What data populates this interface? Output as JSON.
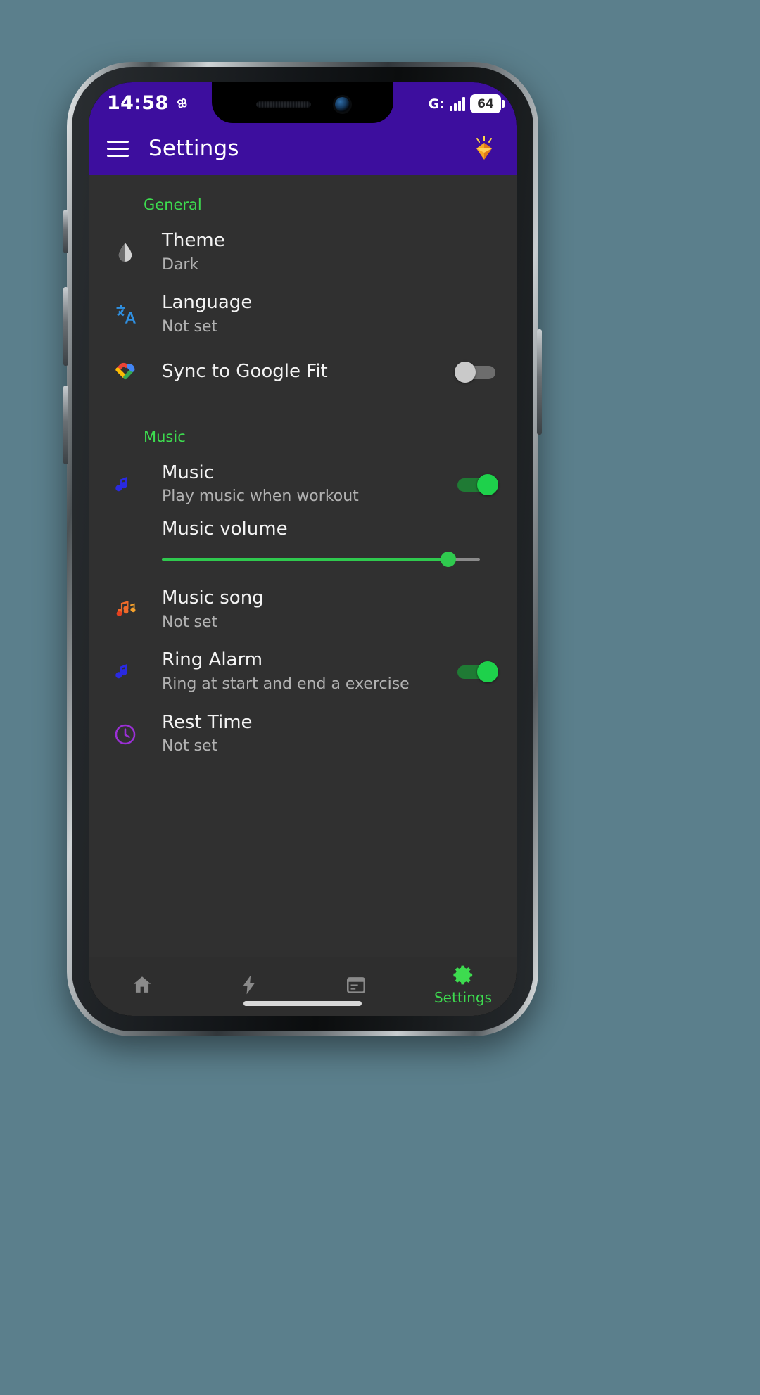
{
  "statusbar": {
    "clock": "14:58",
    "pinwheel_icon": "pinwheel-icon",
    "network_label": "G:",
    "signal_icon": "signal-bars-icon",
    "battery_level": "64"
  },
  "appbar": {
    "menu_icon": "hamburger-menu-icon",
    "title": "Settings",
    "premium_icon": "diamond-gem-icon",
    "background_color": "#3d0e9e"
  },
  "colors": {
    "accent_green": "#3ddb4f",
    "toggle_on": "#1ed14b",
    "toggle_off": "#c9c9c9",
    "content_bg": "#303030"
  },
  "sections": [
    {
      "header": "General",
      "items": [
        {
          "icon": "theme-droplet-icon",
          "title": "Theme",
          "subtitle": "Dark",
          "control": "none"
        },
        {
          "icon": "translate-language-icon",
          "title": "Language",
          "subtitle": "Not set",
          "control": "none"
        },
        {
          "icon": "google-fit-heart-icon",
          "title": "Sync to Google Fit",
          "subtitle": "",
          "control": "toggle",
          "toggle_state": "off"
        }
      ]
    },
    {
      "header": "Music",
      "items": [
        {
          "icon": "music-note-icon",
          "title": "Music",
          "subtitle": "Play music when workout",
          "control": "toggle",
          "toggle_state": "on"
        },
        {
          "icon": "none",
          "title": "Music volume",
          "subtitle": "",
          "control": "slider",
          "slider_percent": 90
        },
        {
          "icon": "music-notes-multi-icon",
          "title": "Music song",
          "subtitle": "Not set",
          "control": "none"
        },
        {
          "icon": "music-note-icon",
          "title": "Ring Alarm",
          "subtitle": "Ring at start and end a exercise",
          "control": "toggle",
          "toggle_state": "on"
        },
        {
          "icon": "clock-icon",
          "title": "Rest Time",
          "subtitle": "Not set",
          "control": "none"
        }
      ]
    }
  ],
  "bottomnav": {
    "items": [
      {
        "icon": "home-icon",
        "label": "",
        "active": false
      },
      {
        "icon": "lightning-bolt-icon",
        "label": "",
        "active": false
      },
      {
        "icon": "calendar-icon",
        "label": "",
        "active": false
      },
      {
        "icon": "gear-settings-icon",
        "label": "Settings",
        "active": true
      }
    ]
  }
}
